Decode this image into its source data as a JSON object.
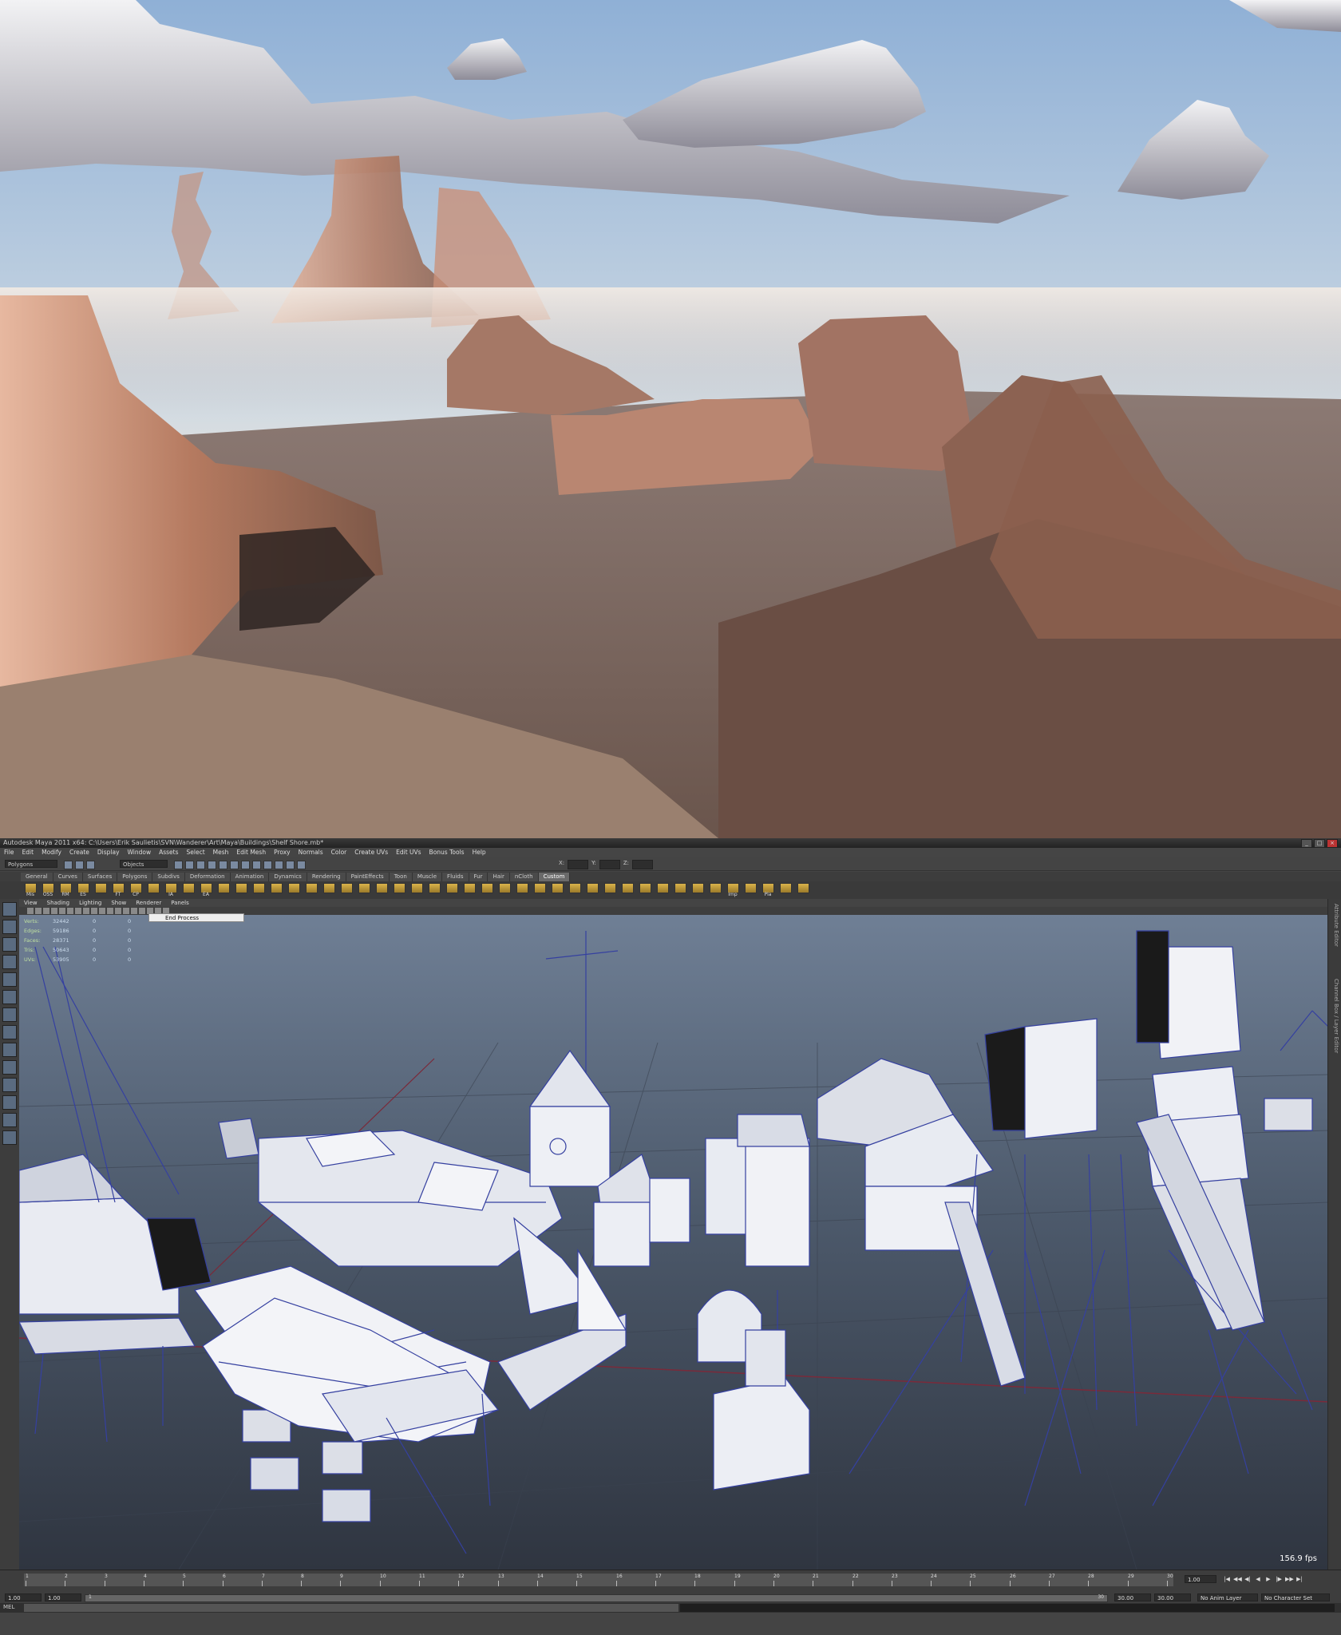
{
  "maya": {
    "title": "Autodesk Maya 2011 x64: C:\\Users\\Erik Saulietis\\SVN\\Wanderer\\Art\\Maya\\Buildings\\Shelf Shore.mb*",
    "window_buttons": [
      "_",
      "□",
      "×"
    ],
    "menus": [
      "File",
      "Edit",
      "Modify",
      "Create",
      "Display",
      "Window",
      "Assets",
      "Select",
      "Mesh",
      "Edit Mesh",
      "Proxy",
      "Normals",
      "Color",
      "Create UVs",
      "Edit UVs",
      "Bonus Tools",
      "Help"
    ],
    "mode": "Polygons",
    "selection_field": "Objects",
    "xyz_labels": [
      "X:",
      "Y:",
      "Z:"
    ],
    "shelf_tabs": [
      "General",
      "Curves",
      "Surfaces",
      "Polygons",
      "Subdivs",
      "Deformation",
      "Animation",
      "Dynamics",
      "Rendering",
      "PaintEffects",
      "Toon",
      "Muscle",
      "Fluids",
      "Fur",
      "Hair",
      "nCloth",
      "Custom"
    ],
    "active_shelf_tab": "Custom",
    "shelf_items": [
      "Mis",
      "OSS",
      "RM",
      "ES",
      "",
      "FT",
      "CP",
      "",
      "IA",
      "",
      "EA",
      "",
      "",
      "",
      "",
      "",
      "",
      "",
      "",
      "",
      "",
      "",
      "",
      "",
      "",
      "",
      "",
      "",
      "",
      "",
      "",
      "",
      "",
      "",
      "",
      "",
      "",
      "",
      "",
      "",
      "Imp",
      "",
      "Pla",
      "",
      ""
    ],
    "panel_menus": [
      "View",
      "Shading",
      "Lighting",
      "Show",
      "Renderer",
      "Panels"
    ],
    "tooltip": "End Process",
    "hud": [
      {
        "label": "Verts:",
        "value": "32442",
        "c1": "0",
        "c2": "0"
      },
      {
        "label": "Edges:",
        "value": "59186",
        "c1": "0",
        "c2": "0"
      },
      {
        "label": "Faces:",
        "value": "28371",
        "c1": "0",
        "c2": "0"
      },
      {
        "label": "Tris:",
        "value": "50643",
        "c1": "0",
        "c2": "0"
      },
      {
        "label": "UVs:",
        "value": "53905",
        "c1": "0",
        "c2": "0"
      }
    ],
    "fps": "156.9 fps",
    "dock_labels": [
      "Attribute Editor",
      "Channel Box / Layer Editor"
    ],
    "timeline_ticks": [
      "1",
      "2",
      "3",
      "4",
      "5",
      "6",
      "7",
      "8",
      "9",
      "10",
      "11",
      "12",
      "13",
      "14",
      "15",
      "16",
      "17",
      "18",
      "19",
      "20",
      "21",
      "22",
      "23",
      "24",
      "25",
      "26",
      "27",
      "28",
      "29",
      "30"
    ],
    "current_frame": "1.00",
    "play_buttons": [
      "|◀",
      "◀◀",
      "◀|",
      "◀",
      "▶",
      "|▶",
      "▶▶",
      "▶|"
    ],
    "range_start": "1.00",
    "range_start2": "1.00",
    "range_bar_start": "1",
    "range_bar_end": "30",
    "range_end": "30.00",
    "range_end2": "30.00",
    "anim_layer": "No Anim Layer",
    "char_set": "No Character Set",
    "mel_label": "MEL"
  }
}
